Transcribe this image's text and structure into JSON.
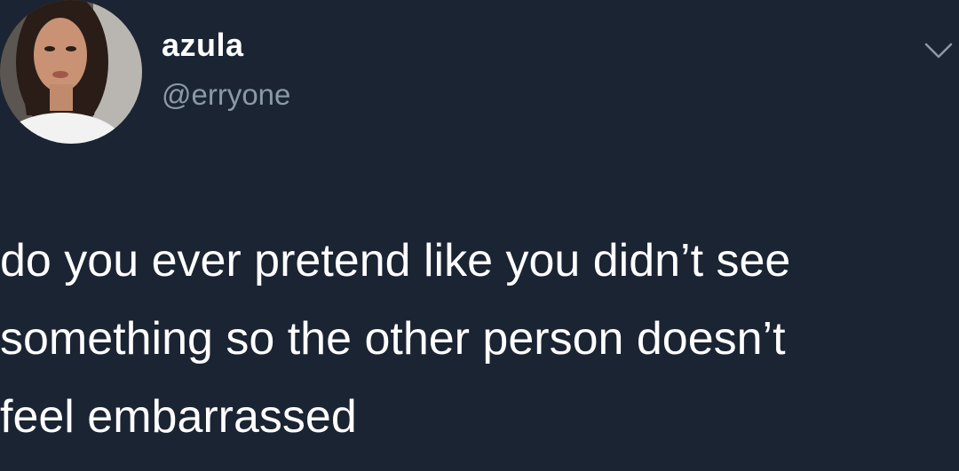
{
  "tweet": {
    "author": {
      "display_name": "azula",
      "handle": "@erryone"
    },
    "text_lines": [
      "do you ever pretend like you didn’t see",
      "something so the other person doesn’t",
      "feel embarrassed"
    ]
  },
  "icons": {
    "menu": "chevron-down-icon",
    "avatar": "profile-photo"
  },
  "colors": {
    "background": "#1b2433",
    "text": "#ffffff",
    "handle": "#8a99a8",
    "chevron": "#8a99a8"
  }
}
